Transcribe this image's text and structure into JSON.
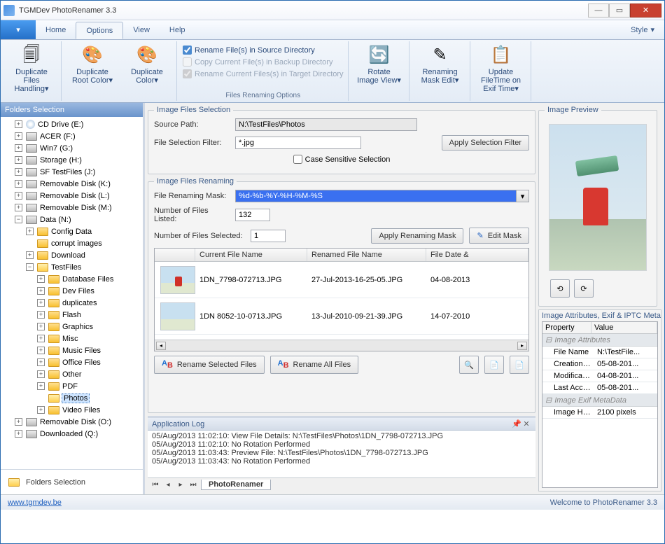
{
  "title": "TGMDev PhotoRenamer 3.3",
  "menu": {
    "home": "Home",
    "options": "Options",
    "view": "View",
    "help": "Help",
    "style": "Style"
  },
  "ribbon": {
    "dup_files": "Duplicate Files Handling",
    "dup_root": "Duplicate Root Color",
    "dup_color": "Duplicate Color",
    "chk_rename_src": "Rename File(s) in Source Directory",
    "chk_copy_backup": "Copy Current File(s) in Backup Directory",
    "chk_rename_target": "Rename Current Files(s) in Target Directory",
    "group_label": "Files Renaming Options",
    "rotate": "Rotate Image View",
    "mask_edit": "Renaming Mask Edit",
    "update_ft": "Update FileTime on Exif Time"
  },
  "sidebar": {
    "title": "Folders Selection",
    "footer": "Folders Selection",
    "nodes": [
      {
        "ind": 1,
        "exp": "+",
        "icon": "cd",
        "label": "CD Drive (E:)"
      },
      {
        "ind": 1,
        "exp": "+",
        "icon": "drive",
        "label": "ACER (F:)"
      },
      {
        "ind": 1,
        "exp": "+",
        "icon": "drive",
        "label": "Win7 (G:)"
      },
      {
        "ind": 1,
        "exp": "+",
        "icon": "drive",
        "label": "Storage (H:)"
      },
      {
        "ind": 1,
        "exp": "+",
        "icon": "drive",
        "label": "SF TestFiles (J:)"
      },
      {
        "ind": 1,
        "exp": "+",
        "icon": "drive",
        "label": "Removable Disk (K:)"
      },
      {
        "ind": 1,
        "exp": "+",
        "icon": "drive",
        "label": "Removable Disk (L:)"
      },
      {
        "ind": 1,
        "exp": "+",
        "icon": "drive",
        "label": "Removable Disk (M:)"
      },
      {
        "ind": 1,
        "exp": "−",
        "icon": "drive",
        "label": "Data (N:)"
      },
      {
        "ind": 2,
        "exp": "+",
        "icon": "folder",
        "label": "Config Data"
      },
      {
        "ind": 2,
        "exp": "",
        "icon": "folder",
        "label": "corrupt images"
      },
      {
        "ind": 2,
        "exp": "+",
        "icon": "folder",
        "label": "Download"
      },
      {
        "ind": 2,
        "exp": "−",
        "icon": "folder open",
        "label": "TestFiles"
      },
      {
        "ind": 3,
        "exp": "+",
        "icon": "folder",
        "label": "Database Files"
      },
      {
        "ind": 3,
        "exp": "+",
        "icon": "folder",
        "label": "Dev Files"
      },
      {
        "ind": 3,
        "exp": "+",
        "icon": "folder",
        "label": "duplicates"
      },
      {
        "ind": 3,
        "exp": "+",
        "icon": "folder",
        "label": "Flash"
      },
      {
        "ind": 3,
        "exp": "+",
        "icon": "folder",
        "label": "Graphics"
      },
      {
        "ind": 3,
        "exp": "+",
        "icon": "folder",
        "label": "Misc"
      },
      {
        "ind": 3,
        "exp": "+",
        "icon": "folder",
        "label": "Music Files"
      },
      {
        "ind": 3,
        "exp": "+",
        "icon": "folder",
        "label": "Office Files"
      },
      {
        "ind": 3,
        "exp": "+",
        "icon": "folder",
        "label": "Other"
      },
      {
        "ind": 3,
        "exp": "+",
        "icon": "folder",
        "label": "PDF"
      },
      {
        "ind": 3,
        "exp": "",
        "icon": "folder open",
        "label": "Photos",
        "sel": true
      },
      {
        "ind": 3,
        "exp": "+",
        "icon": "folder",
        "label": "Video Files"
      },
      {
        "ind": 1,
        "exp": "+",
        "icon": "drive",
        "label": "Removable Disk (O:)"
      },
      {
        "ind": 1,
        "exp": "+",
        "icon": "drive",
        "label": "Downloaded (Q:)"
      }
    ]
  },
  "selection": {
    "legend": "Image Files Selection",
    "source_lbl": "Source Path:",
    "source_val": "N:\\TestFiles\\Photos",
    "filter_lbl": "File Selection Filter:",
    "filter_val": "*.jpg",
    "apply_filter": "Apply Selection Filter",
    "case_lbl": "Case Sensitive Selection"
  },
  "renaming": {
    "legend": "Image Files Renaming",
    "mask_lbl": "File Renaming Mask:",
    "mask_val": "%d-%b-%Y-%H-%M-%S",
    "listed_lbl": "Number of Files Listed:",
    "listed_val": "132",
    "selected_lbl": "Number of Files Selected:",
    "selected_val": "1",
    "apply_mask": "Apply Renaming Mask",
    "edit_mask": "Edit Mask",
    "cols": {
      "c1": "Current File Name",
      "c2": "Renamed File Name",
      "c3": "File Date & "
    },
    "rows": [
      {
        "cur": "1DN_7798-072713.JPG",
        "ren": "27-Jul-2013-16-25-05.JPG",
        "date": "04-08-2013"
      },
      {
        "cur": "1DN  8052-10-0713.JPG",
        "ren": "13-Jul-2010-09-21-39.JPG",
        "date": "14-07-2010"
      }
    ],
    "rename_sel": "Rename Selected Files",
    "rename_all": "Rename All Files"
  },
  "preview": {
    "legend": "Image Preview"
  },
  "attrs": {
    "legend": "Image Attributes, Exif & IPTC MetaData",
    "col1": "Property",
    "col2": "Value",
    "cat1": "Image Attributes",
    "rows1": [
      {
        "p": "File Name",
        "v": "N:\\TestFile..."
      },
      {
        "p": "Creation Ti...",
        "v": "05-08-201..."
      },
      {
        "p": "Modificatio...",
        "v": "04-08-201..."
      },
      {
        "p": "Last Acces...",
        "v": "05-08-201..."
      }
    ],
    "cat2": "Image Exif MetaData",
    "rows2": [
      {
        "p": "Image Height",
        "v": "2100 pixels"
      }
    ]
  },
  "log": {
    "title": "Application Log",
    "lines": [
      "05/Aug/2013 11:02:10: View File Details: N:\\TestFiles\\Photos\\1DN_7798-072713.JPG",
      "05/Aug/2013 11:02:10: No Rotation Performed",
      "05/Aug/2013 11:03:43: Preview File: N:\\TestFiles\\Photos\\1DN_7798-072713.JPG",
      "05/Aug/2013 11:03:43: No Rotation Performed"
    ],
    "tab": "PhotoRenamer"
  },
  "status": {
    "link": "www.tgmdev.be",
    "msg": "Welcome to PhotoRenamer 3.3"
  }
}
